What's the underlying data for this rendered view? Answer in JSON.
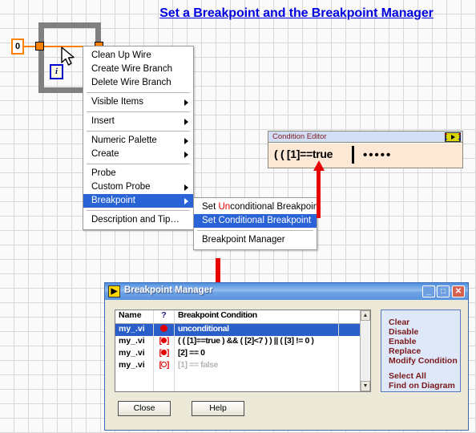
{
  "page": {
    "title": "Set a Breakpoint and the Breakpoint Manager"
  },
  "diagram": {
    "constant_value": "0",
    "iteration_terminal": "i"
  },
  "context_menu": {
    "items": [
      {
        "label": "Clean Up Wire",
        "submenu": false,
        "selected": false
      },
      {
        "label": "Create Wire Branch",
        "submenu": false,
        "selected": false
      },
      {
        "label": "Delete Wire Branch",
        "submenu": false,
        "selected": false
      },
      {
        "separator": true
      },
      {
        "label": "Visible Items",
        "submenu": true,
        "selected": false
      },
      {
        "separator": true
      },
      {
        "label": "Insert",
        "submenu": true,
        "selected": false
      },
      {
        "separator": true
      },
      {
        "label": "Numeric Palette",
        "submenu": true,
        "selected": false
      },
      {
        "label": "Create",
        "submenu": true,
        "selected": false
      },
      {
        "separator": true
      },
      {
        "label": "Probe",
        "submenu": false,
        "selected": false
      },
      {
        "label": "Custom Probe",
        "submenu": true,
        "selected": false
      },
      {
        "label": "Breakpoint",
        "submenu": true,
        "selected": true
      },
      {
        "separator": true
      },
      {
        "label": "Description and Tip…",
        "submenu": false,
        "selected": false
      }
    ]
  },
  "breakpoint_submenu": {
    "items": [
      {
        "label": "Set Unconditional Breakpoint",
        "selected": false,
        "highlight_prefix": "Set ",
        "highlight_red": "Un",
        "highlight_suffix": "conditional Breakpoint"
      },
      {
        "label": "Set Conditional Breakpoint",
        "selected": true
      },
      {
        "separator": true
      },
      {
        "label": "Breakpoint Manager",
        "selected": false
      }
    ]
  },
  "condition_editor": {
    "title": "Condition Editor",
    "expression": "( ( [1]==true",
    "dots": "•••••",
    "icon": "labview-vi-icon"
  },
  "breakpoint_manager": {
    "title": "Breakpoint Manager",
    "window_buttons": {
      "minimize": "_",
      "maximize": "□",
      "close": "✕"
    },
    "table": {
      "columns": [
        "Name",
        "?",
        "Breakpoint Condition",
        ""
      ],
      "rows": [
        {
          "name": "my_.vi",
          "state": "solid",
          "condition": "unconditional",
          "selected": true,
          "dim": false
        },
        {
          "name": "my_.vi",
          "state": "bracket-solid",
          "condition": "( ( [1]==true )  &&  ( [2]<7 ) )  ||  ( [3] != 0 )",
          "selected": false,
          "dim": false
        },
        {
          "name": "my_.vi",
          "state": "bracket-solid",
          "condition": "[2] == 0",
          "selected": false,
          "dim": false
        },
        {
          "name": "my_.vi",
          "state": "bracket-ring",
          "condition": "[1] == false",
          "selected": false,
          "dim": true
        }
      ],
      "scrollbar": {
        "up": "▲",
        "down": "▼"
      }
    },
    "actions": {
      "group1": [
        "Clear",
        "Disable",
        "Enable",
        "Replace",
        "Modify Condition"
      ],
      "group2": [
        "Select All",
        "Find on Diagram"
      ]
    },
    "buttons": {
      "close": "Close",
      "help": "Help"
    }
  },
  "colors": {
    "title_blue": "#0000e0",
    "menu_highlight": "#2a63d6",
    "arrow_red": "#e60000",
    "wire_orange": "#ff8000",
    "action_text": "#7a1a1a",
    "table_header": "#1a1a8c"
  }
}
